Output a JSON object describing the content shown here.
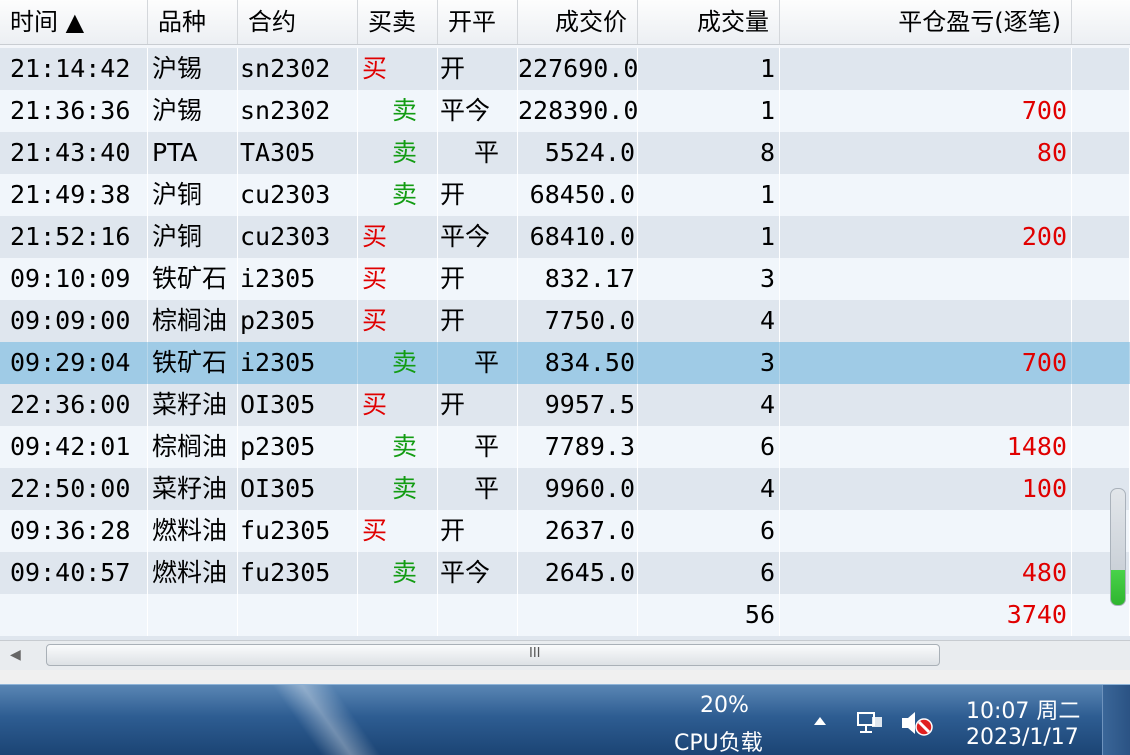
{
  "grid": {
    "columns": [
      {
        "label": "时间 ▲"
      },
      {
        "label": "品种"
      },
      {
        "label": "合约"
      },
      {
        "label": "买卖"
      },
      {
        "label": "开平"
      },
      {
        "label": "成交价"
      },
      {
        "label": "成交量"
      },
      {
        "label": "平仓盈亏(逐笔)"
      }
    ],
    "rows": [
      {
        "time": "21:14:42",
        "variety": "沪锡",
        "contract": "sn2302",
        "side": "买",
        "side_type": "buy",
        "openclose": "开",
        "price": "227690.0",
        "qty": "1",
        "pnl": ""
      },
      {
        "time": "21:36:36",
        "variety": "沪锡",
        "contract": "sn2302",
        "side": "卖",
        "side_type": "sell",
        "openclose": "平今",
        "price": "228390.0",
        "qty": "1",
        "pnl": "700"
      },
      {
        "time": "21:43:40",
        "variety": "PTA",
        "contract": "TA305",
        "side": "卖",
        "side_type": "sell",
        "openclose": "平",
        "price": "5524.0",
        "qty": "8",
        "pnl": "80"
      },
      {
        "time": "21:49:38",
        "variety": "沪铜",
        "contract": "cu2303",
        "side": "卖",
        "side_type": "sell",
        "openclose": "开",
        "price": "68450.0",
        "qty": "1",
        "pnl": ""
      },
      {
        "time": "21:52:16",
        "variety": "沪铜",
        "contract": "cu2303",
        "side": "买",
        "side_type": "buy",
        "openclose": "平今",
        "price": "68410.0",
        "qty": "1",
        "pnl": "200"
      },
      {
        "time": "09:10:09",
        "variety": "铁矿石",
        "contract": "i2305",
        "side": "买",
        "side_type": "buy",
        "openclose": "开",
        "price": "832.17",
        "qty": "3",
        "pnl": ""
      },
      {
        "time": "09:09:00",
        "variety": "棕榈油",
        "contract": "p2305",
        "side": "买",
        "side_type": "buy",
        "openclose": "开",
        "price": "7750.0",
        "qty": "4",
        "pnl": ""
      },
      {
        "time": "09:29:04",
        "variety": "铁矿石",
        "contract": "i2305",
        "side": "卖",
        "side_type": "sell",
        "openclose": "平",
        "price": "834.50",
        "qty": "3",
        "pnl": "700",
        "selected": true
      },
      {
        "time": "22:36:00",
        "variety": "菜籽油",
        "contract": "OI305",
        "side": "买",
        "side_type": "buy",
        "openclose": "开",
        "price": "9957.5",
        "qty": "4",
        "pnl": ""
      },
      {
        "time": "09:42:01",
        "variety": "棕榈油",
        "contract": "p2305",
        "side": "卖",
        "side_type": "sell",
        "openclose": "平",
        "price": "7789.3",
        "qty": "6",
        "pnl": "1480"
      },
      {
        "time": "22:50:00",
        "variety": "菜籽油",
        "contract": "OI305",
        "side": "卖",
        "side_type": "sell",
        "openclose": "平",
        "price": "9960.0",
        "qty": "4",
        "pnl": "100"
      },
      {
        "time": "09:36:28",
        "variety": "燃料油",
        "contract": "fu2305",
        "side": "买",
        "side_type": "buy",
        "openclose": "开",
        "price": "2637.0",
        "qty": "6",
        "pnl": ""
      },
      {
        "time": "09:40:57",
        "variety": "燃料油",
        "contract": "fu2305",
        "side": "卖",
        "side_type": "sell",
        "openclose": "平今",
        "price": "2645.0",
        "qty": "6",
        "pnl": "480"
      }
    ],
    "totals": {
      "qty": "56",
      "pnl": "3740"
    }
  },
  "colors": {
    "buy": "#e00000",
    "sell": "#139c13",
    "pnl": "#e00000",
    "selected_row": "#9fcbe6"
  },
  "taskbar": {
    "cpu_percent": "20%",
    "cpu_label": "CPU负载",
    "clock_time": "10:07 周二",
    "clock_date": "2023/1/17",
    "tray_icons": [
      "show-hidden-icons-arrow",
      "network-icon",
      "volume-muted-icon"
    ]
  },
  "hscroll": {
    "grip": "III"
  }
}
